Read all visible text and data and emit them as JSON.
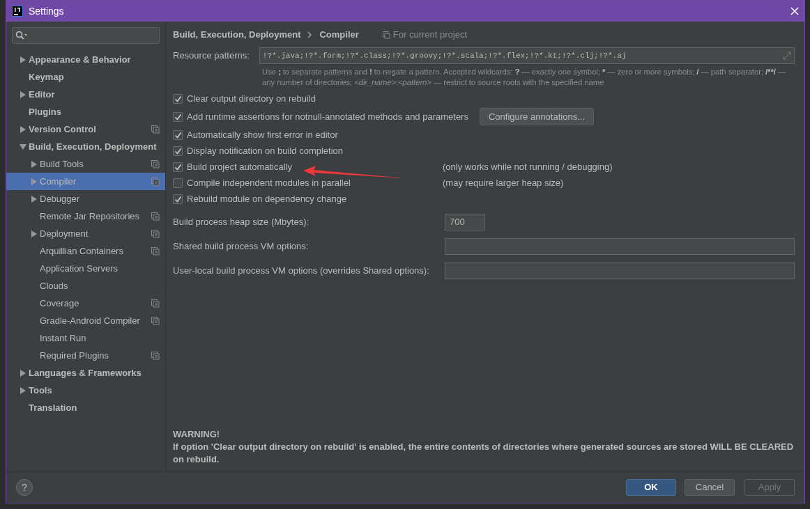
{
  "window": {
    "title": "Settings"
  },
  "sidebar": {
    "items": [
      {
        "label": "Appearance & Behavior",
        "kind": "node",
        "expanded": false,
        "selected": false,
        "project_level": false
      },
      {
        "label": "Keymap",
        "kind": "leaf",
        "selected": false,
        "project_level": false
      },
      {
        "label": "Editor",
        "kind": "node",
        "expanded": false,
        "selected": false,
        "project_level": false
      },
      {
        "label": "Plugins",
        "kind": "leaf",
        "selected": false,
        "project_level": false
      },
      {
        "label": "Version Control",
        "kind": "node",
        "expanded": false,
        "selected": false,
        "project_level": true
      },
      {
        "label": "Build, Execution, Deployment",
        "kind": "node",
        "expanded": true,
        "selected": false,
        "project_level": false,
        "children": [
          {
            "label": "Build Tools",
            "kind": "node",
            "expanded": false,
            "selected": false,
            "project_level": true
          },
          {
            "label": "Compiler",
            "kind": "node",
            "expanded": false,
            "selected": true,
            "project_level": true
          },
          {
            "label": "Debugger",
            "kind": "node",
            "expanded": false,
            "selected": false,
            "project_level": false
          },
          {
            "label": "Remote Jar Repositories",
            "kind": "leaf",
            "selected": false,
            "project_level": true
          },
          {
            "label": "Deployment",
            "kind": "node",
            "expanded": false,
            "selected": false,
            "project_level": true
          },
          {
            "label": "Arquillian Containers",
            "kind": "leaf",
            "selected": false,
            "project_level": true
          },
          {
            "label": "Application Servers",
            "kind": "leaf",
            "selected": false,
            "project_level": false
          },
          {
            "label": "Clouds",
            "kind": "leaf",
            "selected": false,
            "project_level": false
          },
          {
            "label": "Coverage",
            "kind": "leaf",
            "selected": false,
            "project_level": true
          },
          {
            "label": "Gradle-Android Compiler",
            "kind": "leaf",
            "selected": false,
            "project_level": true
          },
          {
            "label": "Instant Run",
            "kind": "leaf",
            "selected": false,
            "project_level": false
          },
          {
            "label": "Required Plugins",
            "kind": "leaf",
            "selected": false,
            "project_level": true
          }
        ]
      },
      {
        "label": "Languages & Frameworks",
        "kind": "node",
        "expanded": false,
        "selected": false,
        "project_level": false
      },
      {
        "label": "Tools",
        "kind": "node",
        "expanded": false,
        "selected": false,
        "project_level": false
      },
      {
        "label": "Translation",
        "kind": "leaf",
        "selected": false,
        "project_level": false
      }
    ]
  },
  "breadcrumb": [
    "Build, Execution, Deployment",
    "Compiler"
  ],
  "scope": "For current project",
  "resource_patterns": {
    "label": "Resource patterns:",
    "value": "!?*.java;!?*.form;!?*.class;!?*.groovy;!?*.scala;!?*.flex;!?*.kt;!?*.clj;!?*.aj"
  },
  "hint": [
    {
      "kind": "plain",
      "text": "Use "
    },
    {
      "kind": "bold",
      "text": ";"
    },
    {
      "kind": "plain",
      "text": " to separate patterns and "
    },
    {
      "kind": "bold",
      "text": "!"
    },
    {
      "kind": "plain",
      "text": " to negate a pattern. Accepted wildcards: "
    },
    {
      "kind": "bold",
      "text": "?"
    },
    {
      "kind": "plain",
      "text": " — exactly one symbol; "
    },
    {
      "kind": "bold",
      "text": "*"
    },
    {
      "kind": "plain",
      "text": " — zero or more symbols; "
    },
    {
      "kind": "bold",
      "text": "/"
    },
    {
      "kind": "plain",
      "text": " — path separator; "
    },
    {
      "kind": "bold",
      "text": "/**/"
    },
    {
      "kind": "plain",
      "text": " — any number of directories; "
    },
    {
      "kind": "italic",
      "text": "<dir_name>"
    },
    {
      "kind": "plain",
      "text": ":"
    },
    {
      "kind": "italic",
      "text": "<pattern>"
    },
    {
      "kind": "plain",
      "text": " — restrict to source roots with the specified name"
    }
  ],
  "options": [
    {
      "label": "Clear output directory on rebuild",
      "checked": true
    },
    {
      "label": "Add runtime assertions for notnull-annotated methods and parameters",
      "checked": true,
      "button": "Configure annotations..."
    },
    {
      "label": "Automatically show first error in editor",
      "checked": true
    },
    {
      "label": "Display notification on build completion",
      "checked": true
    },
    {
      "label": "Build project automatically",
      "checked": true,
      "note": "(only works while not running / debugging)"
    },
    {
      "label": "Compile independent modules in parallel",
      "checked": false,
      "note": "(may require larger heap size)"
    },
    {
      "label": "Rebuild module on dependency change",
      "checked": true
    }
  ],
  "fields": [
    {
      "label": "Build process heap size (Mbytes):",
      "value": "700",
      "kind": "short"
    },
    {
      "label": "Shared build process VM options:",
      "kind": "wide"
    },
    {
      "label": "User-local build process VM options (overrides Shared options):",
      "kind": "wide"
    }
  ],
  "warning": {
    "title": "WARNING!",
    "text": "If option 'Clear output directory on rebuild' is enabled, the entire contents of directories where generated sources are stored WILL BE CLEARED on rebuild."
  },
  "footer": {
    "help": "?",
    "buttons": [
      {
        "label": "OK",
        "kind": "primary",
        "disabled": false
      },
      {
        "label": "Cancel",
        "kind": "default",
        "disabled": false
      },
      {
        "label": "Apply",
        "kind": "default",
        "disabled": true
      }
    ]
  }
}
